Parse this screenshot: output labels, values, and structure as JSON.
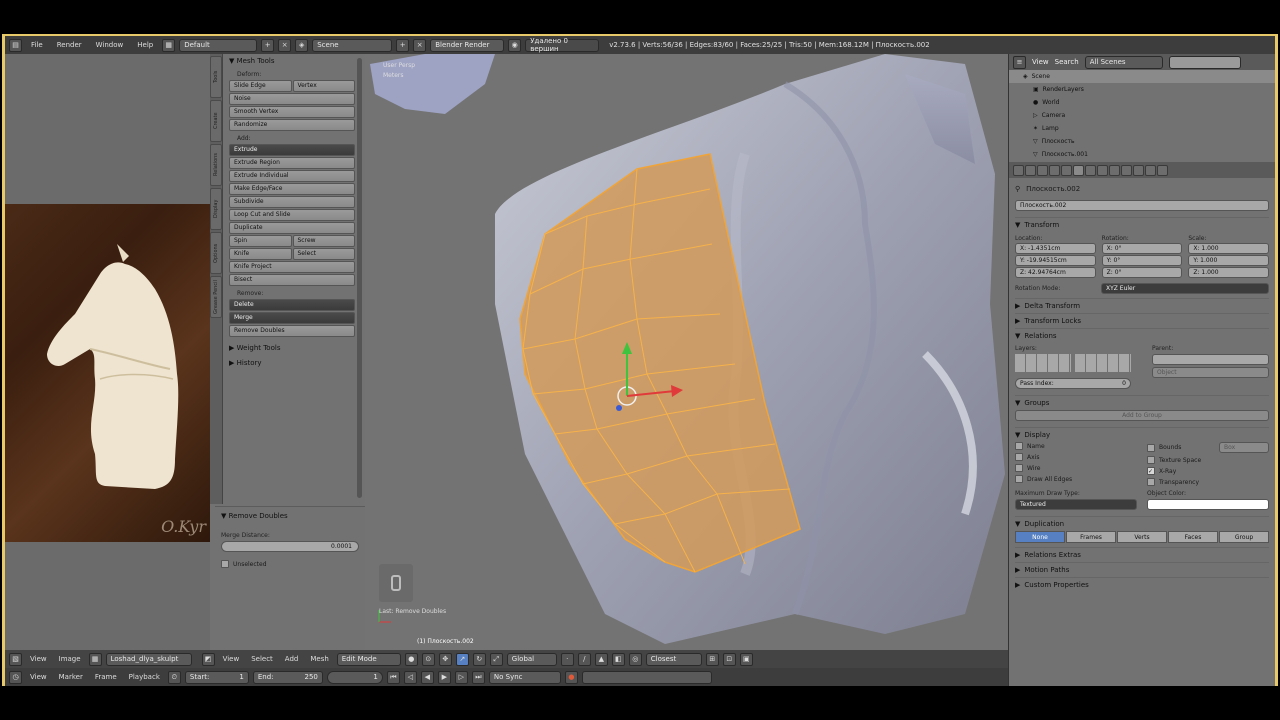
{
  "topbar": {
    "menus": [
      "File",
      "Render",
      "Window",
      "Help"
    ],
    "layout": "Default",
    "scene": "Scene",
    "engine": "Blender Render",
    "notice": "Удалено 0 вершин",
    "stats": "v2.73.6 | Verts:56/36 | Edges:83/60 | Faces:25/25 | Tris:50 | Mem:168.12M | Плоскость.002"
  },
  "toolshelf": {
    "tabs": [
      "Tools",
      "Create",
      "Relations",
      "Display",
      "Options",
      "Grease Pencil"
    ],
    "panel_title": "Mesh Tools",
    "deform_label": "Deform:",
    "deform": [
      "Slide Edge",
      "Vertex",
      "Noise",
      "Smooth Vertex",
      "Randomize"
    ],
    "add_label": "Add:",
    "add": [
      "Extrude",
      "Extrude Region",
      "Extrude Individual",
      "Make Edge/Face",
      "Subdivide",
      "Loop Cut and Slide",
      "Duplicate",
      "Spin",
      "Screw",
      "Knife",
      "Select",
      "Knife Project",
      "Bisect"
    ],
    "remove_label": "Remove:",
    "remove": [
      "Delete",
      "Merge",
      "Remove Doubles"
    ],
    "weight_tools": "Weight Tools",
    "history": "History"
  },
  "redo": {
    "title": "Remove Doubles",
    "merge_label": "Merge Distance:",
    "merge_value": "0.0001",
    "unselected": "Unselected"
  },
  "viewport": {
    "view_label": "User Persp",
    "unit_label": "Meters",
    "last_op": "Last: Remove Doubles",
    "object_label": "(1) Плоскость.002"
  },
  "outliner": {
    "view": "View",
    "search": "Search",
    "scenes": "All Scenes",
    "items": [
      "Scene",
      "RenderLayers",
      "World",
      "Camera",
      "Lamp",
      "Плоскость",
      "Плоскость.001"
    ]
  },
  "props": {
    "breadcrumb": "Плоскость.002",
    "name": "Плоскость.002",
    "transform": "Transform",
    "location": "Location:",
    "rotation": "Rotation:",
    "scale": "Scale:",
    "loc": [
      "X: -1.4351cm",
      "Y: -19.94515cm",
      "Z: 42.94764cm"
    ],
    "rot": [
      "X: 0°",
      "Y: 0°",
      "Z: 0°"
    ],
    "scl": [
      "X: 1.000",
      "Y: 1.000",
      "Z: 1.000"
    ],
    "rotation_mode_label": "Rotation Mode:",
    "rotation_mode": "XYZ Euler",
    "delta": "Delta Transform",
    "locks": "Transform Locks",
    "relations": "Relations",
    "layers": "Layers:",
    "parent": "Parent:",
    "object": "Object",
    "pass_index": "Pass Index:",
    "pass_value": "0",
    "groups": "Groups",
    "add_group": "Add to Group",
    "display": "Display",
    "display_opts_left": [
      "Name",
      "Axis",
      "Wire",
      "Draw All Edges"
    ],
    "display_opts_right": [
      "Bounds",
      "Texture Space",
      "X-Ray",
      "Transparency"
    ],
    "bounds_type": "Box",
    "max_draw_label": "Maximum Draw Type:",
    "max_draw": "Textured",
    "obj_color_label": "Object Color:",
    "duplication": "Duplication",
    "dup_opts": [
      "None",
      "Frames",
      "Verts",
      "Faces",
      "Group"
    ],
    "rel_extras": "Relations Extras",
    "motion_paths": "Motion Paths",
    "custom_props": "Custom Properties"
  },
  "header2": {
    "left": [
      "View",
      "Image"
    ],
    "image_name": "Loshad_dlya_skulpt",
    "menus": [
      "View",
      "Select",
      "Add",
      "Mesh"
    ],
    "mode": "Edit Mode",
    "orientation": "Global",
    "proportional": "Closest"
  },
  "header3": {
    "menus": [
      "View",
      "Marker",
      "Frame",
      "Playback"
    ],
    "start": "Start:",
    "start_val": "1",
    "end": "End:",
    "end_val": "250",
    "frame": "1",
    "sync": "No Sync"
  }
}
